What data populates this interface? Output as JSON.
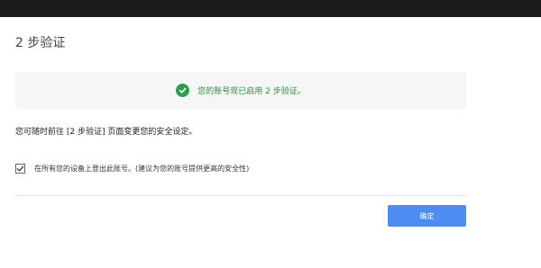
{
  "page": {
    "title": "2 步验证"
  },
  "success": {
    "message": "您的账号现已启用 2 步验证。",
    "icon": "check-circle-icon",
    "color": "#2f9e48"
  },
  "info": {
    "text": "您可随时前往 [2 步验证] 页面变更您的安全设定。"
  },
  "signout_option": {
    "checked": true,
    "label": "在所有您的设备上登出此账号。(建议为您的账号提供更高的安全性)"
  },
  "actions": {
    "confirm_label": "确定",
    "confirm_color": "#4d8cf0"
  }
}
